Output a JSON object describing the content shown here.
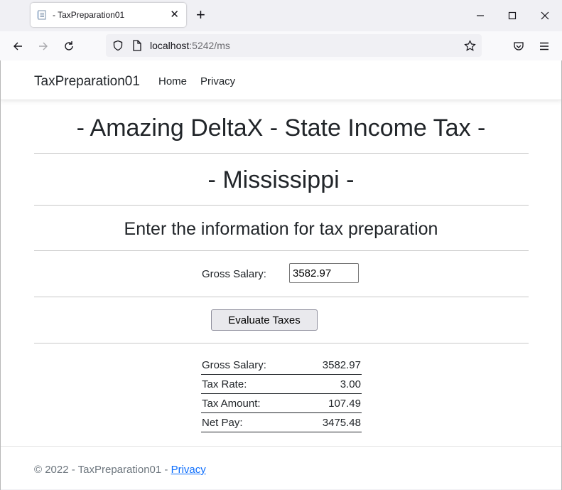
{
  "browser": {
    "tab": {
      "title": "- TaxPreparation01",
      "close": "✕"
    },
    "new_tab": "+",
    "address": {
      "host": "localhost",
      "rest": ":5242/ms"
    }
  },
  "navbar": {
    "brand": "TaxPreparation01",
    "links": [
      "Home",
      "Privacy"
    ]
  },
  "main": {
    "title": "- Amazing DeltaX - State Income Tax -",
    "state": "- Mississippi -",
    "instruction": "Enter the information for tax preparation",
    "form": {
      "salary_label": "Gross Salary:",
      "salary_value": "3582.97",
      "button_label": "Evaluate Taxes"
    },
    "results": [
      {
        "label": "Gross Salary:",
        "value": "3582.97"
      },
      {
        "label": "Tax Rate:",
        "value": "3.00"
      },
      {
        "label": "Tax Amount:",
        "value": "107.49"
      },
      {
        "label": "Net Pay:",
        "value": "3475.48"
      }
    ]
  },
  "footer": {
    "text": "© 2022 - TaxPreparation01 - ",
    "link": "Privacy"
  },
  "icons": {
    "favicon": "page-icon",
    "back": "arrow-left-icon",
    "forward": "arrow-right-icon",
    "reload": "reload-icon",
    "shield": "shield-icon",
    "page": "page-icon",
    "star": "star-icon",
    "pocket": "pocket-icon",
    "menu": "hamburger-menu-icon",
    "minimize": "minimize-icon",
    "maximize": "maximize-icon",
    "close": "close-icon"
  },
  "colors": {
    "link": "#0d6efd",
    "text": "#212529",
    "footer_text": "#6c757d"
  }
}
